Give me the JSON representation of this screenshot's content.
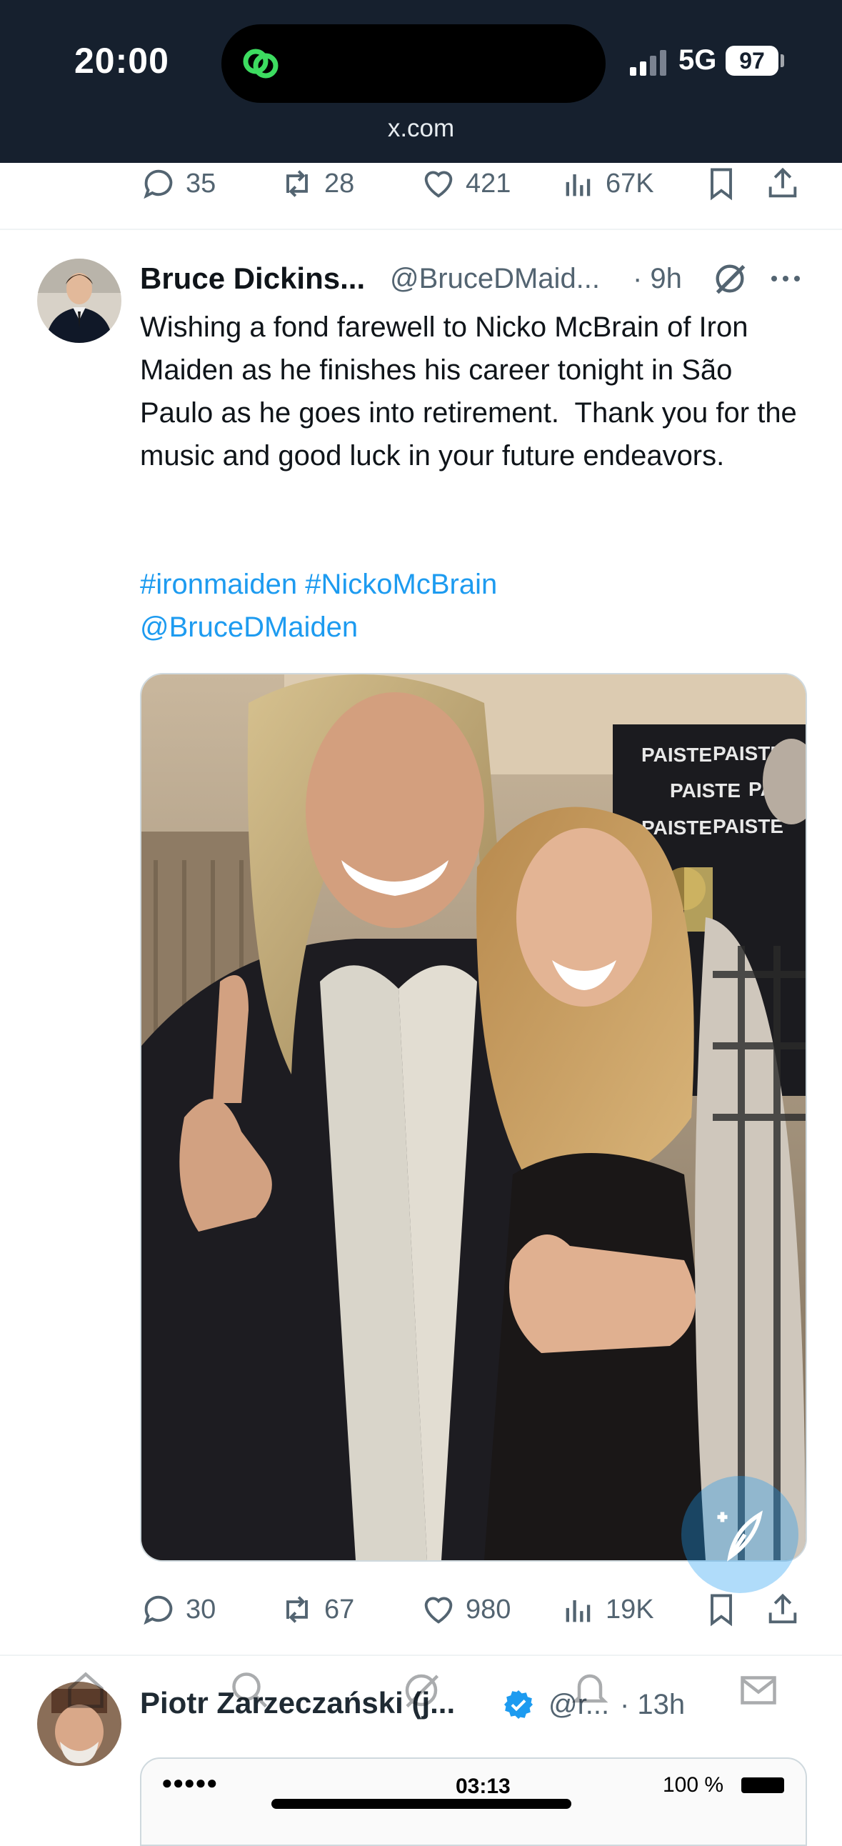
{
  "status_bar": {
    "time": "20:00",
    "network": "5G",
    "battery": "97"
  },
  "browser": {
    "url": "x.com"
  },
  "prev_tweet_actions": {
    "replies": "35",
    "reposts": "28",
    "likes": "421",
    "views": "67K"
  },
  "tweet": {
    "author_name": "Bruce Dickins...",
    "author_handle": "@BruceDMaid...",
    "time": "· 9h",
    "text": "Wishing a fond farewell to Nicko McBrain of Iron Maiden as he finishes his career tonight in São Paulo as he goes into retirement.  Thank you for the music and good luck in your future endeavors.",
    "hashtags": "#ironmaiden #NickoMcBrain",
    "mention": "@BruceDMaiden",
    "backdrop_words": [
      "PAISTE",
      "PAISTE",
      "PAISTE",
      "PAISTE",
      "PAISTE",
      "PAISTE"
    ],
    "actions": {
      "replies": "30",
      "reposts": "67",
      "likes": "980",
      "views": "19K"
    }
  },
  "next_tweet": {
    "author_name": "Piotr Zarzeczański (j...",
    "author_handle": "@r...",
    "time": "· 13h",
    "media_time": "03:13",
    "media_battery": "100 %",
    "media_signal": "●●●●●"
  },
  "colors": {
    "accent": "#1d9bf0",
    "status_bg": "#16202e",
    "muted": "#536471"
  }
}
